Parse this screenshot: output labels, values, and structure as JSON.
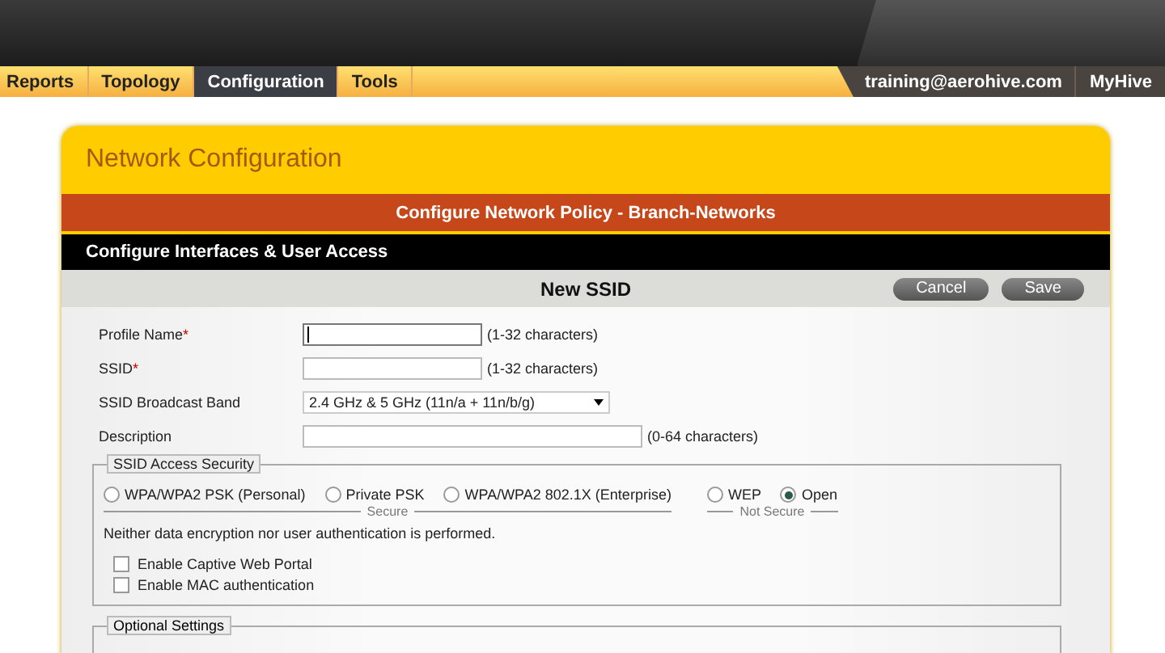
{
  "nav": {
    "tabs": [
      {
        "label": "Reports",
        "selected": false
      },
      {
        "label": "Topology",
        "selected": false
      },
      {
        "label": "Configuration",
        "selected": true
      },
      {
        "label": "Tools",
        "selected": false
      }
    ],
    "user_links": [
      "training@aerohive.com",
      "MyHive"
    ]
  },
  "panel": {
    "title": "Network Configuration",
    "policy_bar": "Configure Network Policy - Branch-Networks",
    "section_bar": "Configure Interfaces & User Access",
    "form_title": "New SSID",
    "buttons": [
      "Cancel",
      "Save"
    ],
    "fields": [
      {
        "kind": "text",
        "label": "Profile Name",
        "required_mark": "*",
        "focused": true,
        "hint": "(1-32 characters)"
      },
      {
        "kind": "text",
        "label": "SSID",
        "required_mark": "*",
        "focused": false,
        "hint": "(1-32 characters)"
      },
      {
        "kind": "select",
        "label": "SSID Broadcast Band",
        "value": "2.4 GHz & 5 GHz (11n/a + 11n/b/g)"
      },
      {
        "kind": "long_text",
        "label": "Description",
        "focused": false,
        "hint": "(0-64 characters)"
      }
    ],
    "security": {
      "legend": "SSID Access Security",
      "groups": [
        {
          "label": "Secure",
          "options": [
            {
              "label": "WPA/WPA2 PSK (Personal)",
              "selected": false
            },
            {
              "label": "Private PSK",
              "selected": false
            },
            {
              "label": "WPA/WPA2 802.1X (Enterprise)",
              "selected": false
            }
          ]
        },
        {
          "label": "Not Secure",
          "options": [
            {
              "label": "WEP",
              "selected": false
            },
            {
              "label": "Open",
              "selected": true
            }
          ]
        }
      ],
      "description": "Neither data encryption nor user authentication is performed.",
      "checkboxes": [
        {
          "label": "Enable Captive Web Portal",
          "checked": false
        },
        {
          "label": "Enable MAC authentication",
          "checked": false
        }
      ]
    },
    "optional_legend": "Optional Settings"
  }
}
